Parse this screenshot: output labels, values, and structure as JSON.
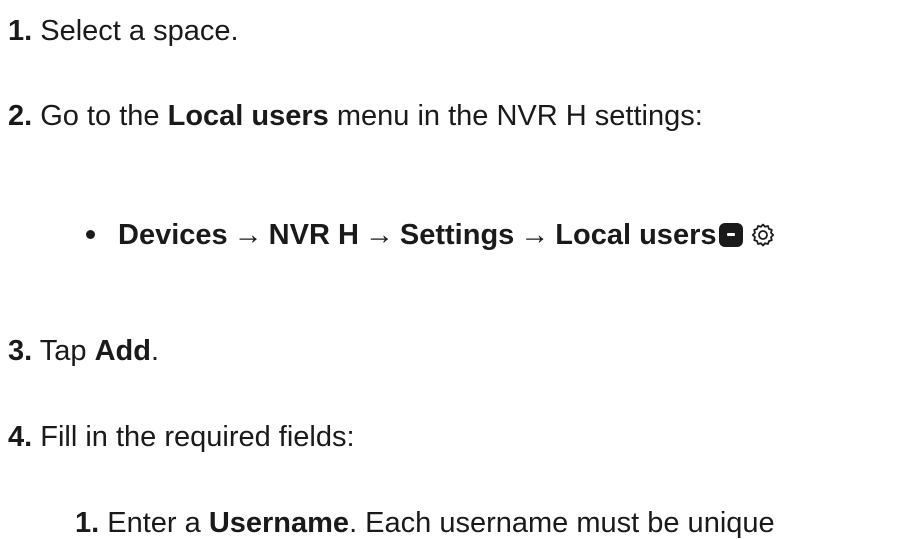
{
  "steps": {
    "s1": {
      "num": "1.",
      "text": "Select a space."
    },
    "s2": {
      "num": "2.",
      "pre": "Go to the",
      "bold": "Local users",
      "post": "menu in the NVR H settings:"
    },
    "path": {
      "devices": "Devices",
      "nvr": "NVR H",
      "settings": "Settings",
      "local_users": "Local users",
      "arrow": "→"
    },
    "s3": {
      "num": "3.",
      "pre": "Tap",
      "bold": "Add",
      "post": "."
    },
    "s4": {
      "num": "4.",
      "text": "Fill in the required fields:"
    },
    "sub1": {
      "num": "1.",
      "pre": "Enter a",
      "bold": "Username",
      "post": ". Each username must be unique"
    }
  },
  "icons": {
    "minus": "minus-square-icon",
    "gear": "gear-icon"
  },
  "colors": {
    "text": "#1a1a1a",
    "background": "#ffffff"
  }
}
